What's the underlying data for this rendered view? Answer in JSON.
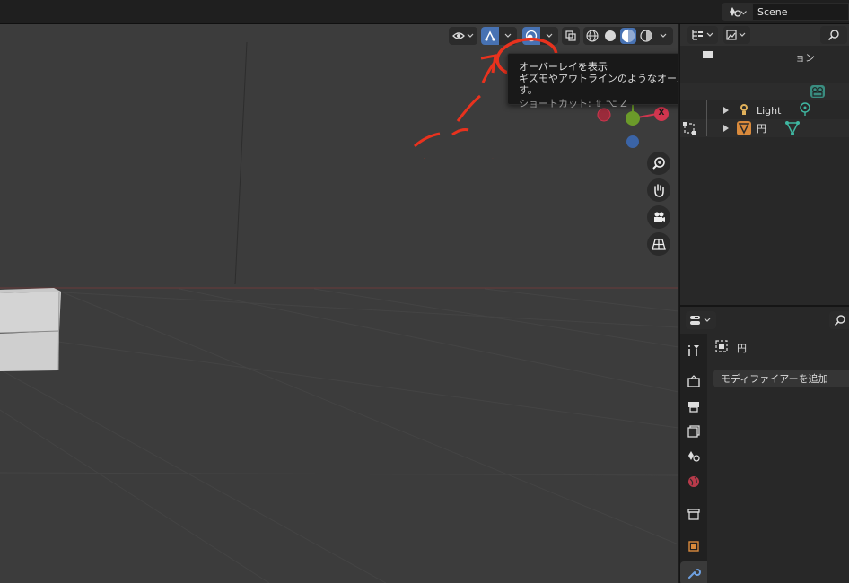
{
  "topbar": {
    "scene_name": "Scene"
  },
  "viewport": {
    "tooltip": {
      "title": "オーバーレイを表示",
      "description": "ギズモやアウトラインのようなオーバーレイを表示します。",
      "shortcut": "ショートカット: ⇧ ⌥ Z"
    },
    "axis_x_label": "X"
  },
  "outliner": {
    "partial_text": "ョン",
    "items": [
      {
        "label": "Light",
        "icon": "light-icon"
      },
      {
        "label": "円",
        "icon": "mesh-icon"
      }
    ]
  },
  "properties": {
    "object_name": "円",
    "add_modifier_label": "モディファイアーを追加"
  },
  "colors": {
    "accent": "#4772b3",
    "annotation": "#e8321e",
    "axis_x": "#d1364f",
    "axis_y": "#6b9a2a",
    "axis_z": "#3b64a6"
  }
}
